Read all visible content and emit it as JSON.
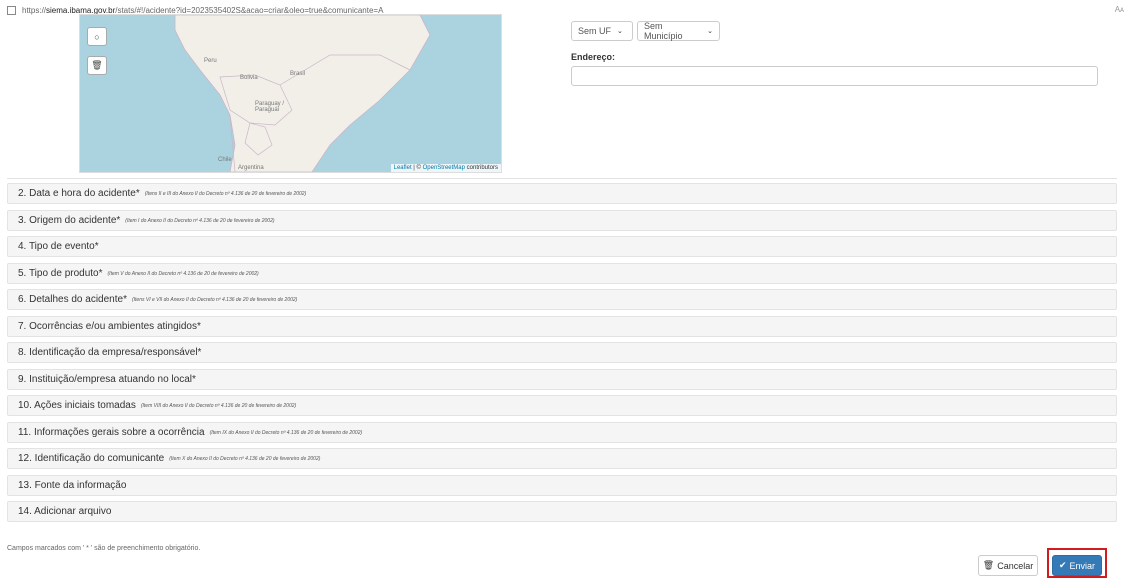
{
  "browser": {
    "url_host": "siema.ibama.gov.br",
    "url_rest": "/stats/#!/acidente?id=2023535402S&acao=criar&oleo=true&comunicante=A",
    "url_scheme": "https://",
    "reader_icon": "Aᴀ"
  },
  "map": {
    "zoom_control_icon": "○",
    "delete_control_icon": "🗑",
    "labels": {
      "peru": "Peru",
      "brasil": "Brasil",
      "bolivia": "Bolivia",
      "paraguay": "Paraguay / Paraguái",
      "chile": "Chile",
      "argentina": "Argentina"
    },
    "attribution_leaflet": "Leaflet",
    "attribution_sep": " | © ",
    "attribution_osm": "OpenStreetMap",
    "attribution_tail": " contributors"
  },
  "location": {
    "uf_select": "Sem UF",
    "municipio_select": "Sem Município",
    "address_label": "Endereço:",
    "address_value": ""
  },
  "sections": [
    {
      "title": "2. Data e hora do acidente*",
      "note": "(Itens II e III do Anexo II do Decreto nº 4.136 de 20 de fevereiro de 2002)"
    },
    {
      "title": "3. Origem do acidente*",
      "note": "(Item I do Anexo II do Decreto nº 4.136 de 20 de fevereiro de 2002)"
    },
    {
      "title": "4. Tipo de evento*",
      "note": ""
    },
    {
      "title": "5. Tipo de produto*",
      "note": "(Item V do Anexo II do Decreto nº 4.136 de 20 de fevereiro de 2002)"
    },
    {
      "title": "6. Detalhes do acidente*",
      "note": "(Itens VI e VII do Anexo II do Decreto nº 4.136 de 20 de fevereiro de 2002)"
    },
    {
      "title": "7. Ocorrências e/ou ambientes atingidos*",
      "note": ""
    },
    {
      "title": "8. Identificação da empresa/responsável*",
      "note": ""
    },
    {
      "title": "9. Instituição/empresa atuando no local*",
      "note": ""
    },
    {
      "title": "10. Ações iniciais tomadas",
      "note": "(Item VIII do Anexo II do Decreto nº 4.136 de 20 de fevereiro de 2002)"
    },
    {
      "title": "11. Informações gerais sobre a ocorrência",
      "note": "(Item IX do Anexo II do Decreto nº 4.136 de 20 de fevereiro de 2002)"
    },
    {
      "title": "12. Identificação do comunicante",
      "note": "(Item X do Anexo II do Decreto nº 4.136 de 20 de fevereiro de 2002)"
    },
    {
      "title": "13. Fonte da informação",
      "note": ""
    },
    {
      "title": "14. Adicionar arquivo",
      "note": ""
    }
  ],
  "footer": {
    "required_note": "Campos marcados com ' * ' são de preenchimento obrigatório.",
    "cancel_label": "Cancelar",
    "send_label": "Enviar",
    "cancel_icon": "trash-icon",
    "send_icon": "check-icon"
  },
  "colors": {
    "primary": "#337ab7",
    "highlight": "#d01c1c",
    "panel_bg": "#f5f5f5"
  }
}
